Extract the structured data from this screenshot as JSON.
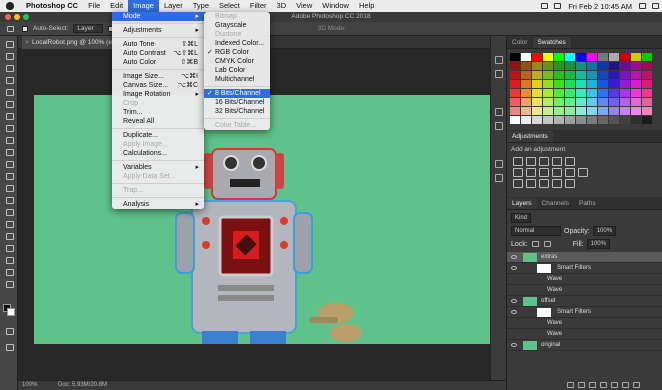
{
  "menubar": {
    "app": "Photoshop CC",
    "items": [
      "File",
      "Edit",
      "Image",
      "Layer",
      "Type",
      "Select",
      "Filter",
      "3D",
      "View",
      "Window",
      "Help"
    ],
    "active": "Image",
    "clock": "Fri Feb 2  10:45 AM"
  },
  "window_title": "Adobe Photoshop CC 2018",
  "options": {
    "auto_select": "Auto-Select:",
    "target": "Layer",
    "show": "Sh",
    "mode3d": "3D Mode:"
  },
  "doc_tab": {
    "close": "×",
    "label": "LocalRobot.png @ 100% (extras..."
  },
  "status": {
    "zoom": "100%",
    "doc": "Doc: 5.93M/20.8M"
  },
  "image_menu": {
    "items": [
      {
        "label": "Mode",
        "submenu": true,
        "highlight": true
      },
      {
        "sep": true
      },
      {
        "label": "Adjustments",
        "submenu": true
      },
      {
        "sep": true
      },
      {
        "label": "Auto Tone",
        "shortcut": "⇧⌘L"
      },
      {
        "label": "Auto Contrast",
        "shortcut": "⌥⇧⌘L"
      },
      {
        "label": "Auto Color",
        "shortcut": "⇧⌘B"
      },
      {
        "sep": true
      },
      {
        "label": "Image Size...",
        "shortcut": "⌥⌘I"
      },
      {
        "label": "Canvas Size...",
        "shortcut": "⌥⌘C"
      },
      {
        "label": "Image Rotation",
        "submenu": true
      },
      {
        "label": "Crop",
        "disabled": true
      },
      {
        "label": "Trim..."
      },
      {
        "label": "Reveal All"
      },
      {
        "sep": true
      },
      {
        "label": "Duplicate..."
      },
      {
        "label": "Apply Image...",
        "disabled": true
      },
      {
        "label": "Calculations..."
      },
      {
        "sep": true
      },
      {
        "label": "Variables",
        "submenu": true
      },
      {
        "label": "Apply Data Set...",
        "disabled": true
      },
      {
        "sep": true
      },
      {
        "label": "Trap...",
        "disabled": true
      },
      {
        "sep": true
      },
      {
        "label": "Analysis",
        "submenu": true
      }
    ]
  },
  "mode_menu": {
    "items": [
      {
        "label": "Bitmap",
        "disabled": true
      },
      {
        "label": "Grayscale"
      },
      {
        "label": "Duotone",
        "disabled": true
      },
      {
        "label": "Indexed Color..."
      },
      {
        "label": "RGB Color",
        "checked": true
      },
      {
        "label": "CMYK Color"
      },
      {
        "label": "Lab Color"
      },
      {
        "label": "Multichannel"
      },
      {
        "sep": true
      },
      {
        "label": "8 Bits/Channel",
        "checked": true,
        "highlight": true
      },
      {
        "label": "16 Bits/Channel"
      },
      {
        "label": "32 Bits/Channel"
      },
      {
        "sep": true
      },
      {
        "label": "Color Table...",
        "disabled": true
      }
    ]
  },
  "panels": {
    "color_tabs": [
      "Color",
      "Swatches"
    ],
    "adjust_tab": "Adjustments",
    "adjust_hint": "Add an adjustment",
    "layer_tabs": [
      "Layers",
      "Channels",
      "Paths"
    ],
    "kind": "Kind",
    "blend": "Normal",
    "opacity_label": "Opacity:",
    "opacity": "100%",
    "lock_label": "Lock:",
    "fill_label": "Fill:",
    "fill": "100%",
    "layers": [
      {
        "name": "extras",
        "level": 0,
        "selected": true
      },
      {
        "name": "Smart Filters",
        "level": 1
      },
      {
        "name": "Wave",
        "level": 2
      },
      {
        "name": "Wave",
        "level": 2
      },
      {
        "name": "offset",
        "level": 0
      },
      {
        "name": "Smart Filters",
        "level": 1
      },
      {
        "name": "Wave",
        "level": 2
      },
      {
        "name": "Wave",
        "level": 2
      },
      {
        "name": "original",
        "level": 0
      }
    ]
  },
  "colors": {
    "canvas": "#5ec28a",
    "accent": "#2f6ce0"
  }
}
